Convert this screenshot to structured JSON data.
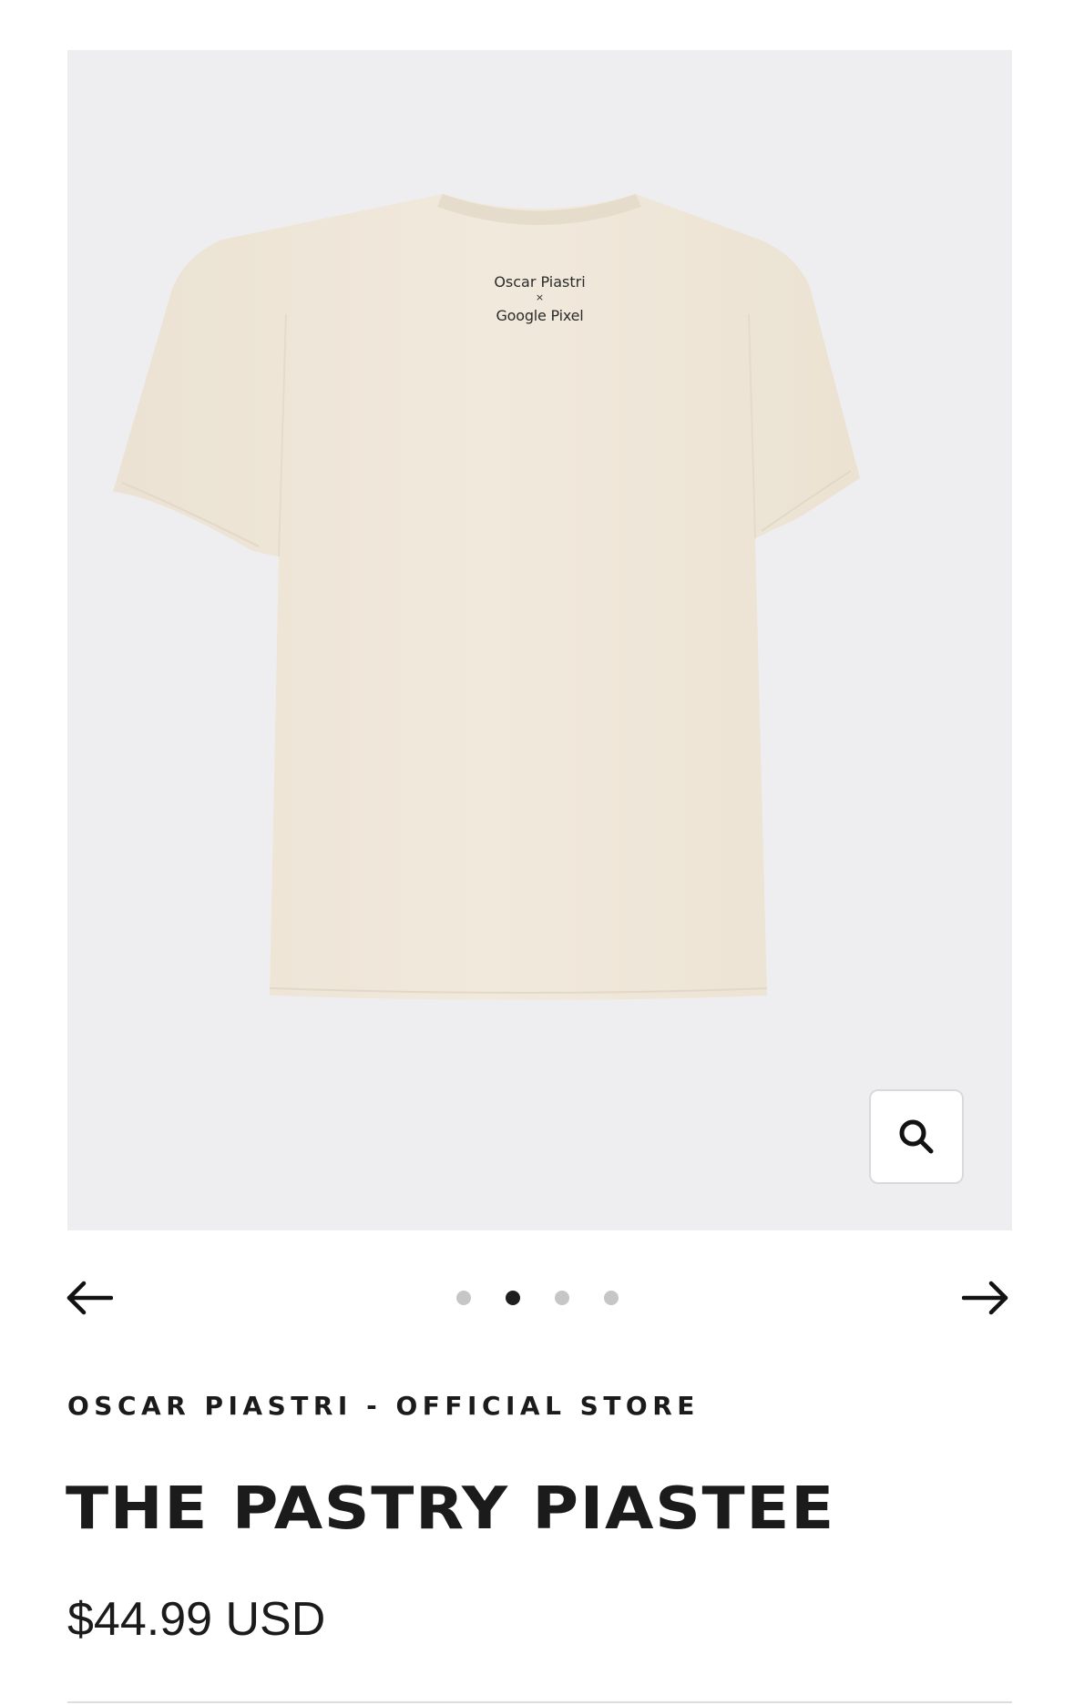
{
  "gallery": {
    "print_text": [
      "Oscar Piastri",
      "×",
      "Google Pixel"
    ],
    "image_icon": "tshirt-back-photo",
    "background_color": "#eeeef1",
    "shirt_color": "#efe7da",
    "zoom_icon": "search-icon",
    "prev_icon": "arrow-left-icon",
    "next_icon": "arrow-right-icon",
    "slide_count": 4,
    "active_slide": 2
  },
  "product": {
    "vendor": "OSCAR PIASTRI - OFFICIAL STORE",
    "title": "THE PASTRY PIASTEE",
    "price": "$44.99 USD"
  }
}
